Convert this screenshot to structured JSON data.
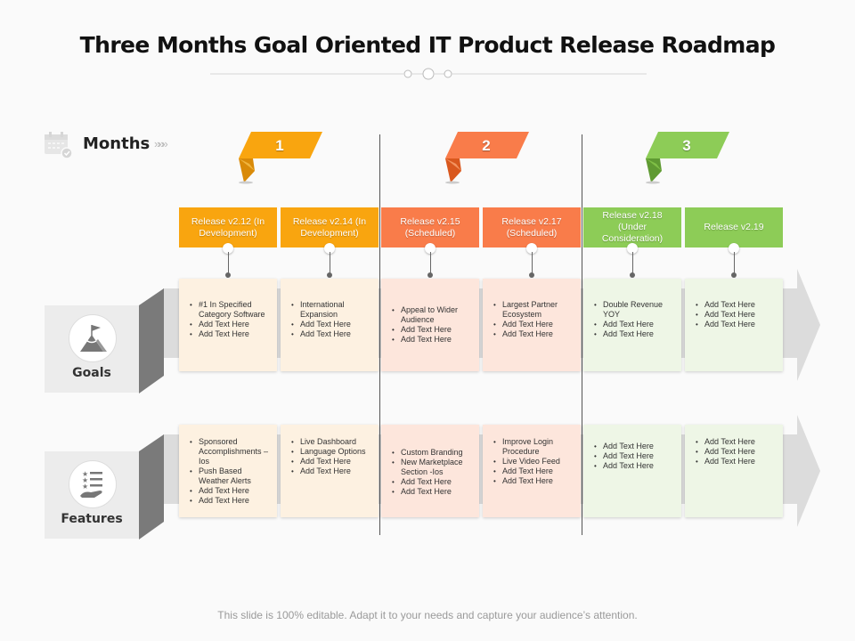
{
  "title": "Three Months Goal Oriented IT Product Release Roadmap",
  "months_header": {
    "label": "Months",
    "chevrons": "»»»",
    "icon": "calendar-check-icon"
  },
  "colors": {
    "month1": "#f9a50f",
    "month2": "#f97c4a",
    "month3": "#8dcc57",
    "month1_cell": "#fdf1e1",
    "month2_cell": "#fde6dc",
    "month3_cell": "#eef6e6",
    "band": "#dcdcdc",
    "fold": "#7a7a7a"
  },
  "months": [
    {
      "number": "1",
      "color_key": "month1"
    },
    {
      "number": "2",
      "color_key": "month2"
    },
    {
      "number": "3",
      "color_key": "month3"
    }
  ],
  "releases": [
    {
      "label": "Release v2.12 (In Development)",
      "month": 1
    },
    {
      "label": "Release v2.14 (In Development)",
      "month": 1
    },
    {
      "label": "Release v2.15 (Scheduled)",
      "month": 2
    },
    {
      "label": "Release v2.17 (Scheduled)",
      "month": 2
    },
    {
      "label": "Release v2.18 (Under Consideration)",
      "month": 3
    },
    {
      "label": "Release v2.19",
      "month": 3
    }
  ],
  "rows": [
    {
      "label": "Goals",
      "icon": "mountain-flag-icon",
      "cells": [
        [
          "#1 In Specified Category Software",
          "Add Text Here",
          "Add Text Here"
        ],
        [
          "International Expansion",
          "Add Text Here",
          "Add Text Here"
        ],
        [
          "Appeal to Wider Audience",
          "Add Text Here",
          "Add Text Here"
        ],
        [
          "Largest Partner Ecosystem",
          "Add Text Here",
          "Add Text Here"
        ],
        [
          "Double Revenue YOY",
          "Add Text Here",
          "Add Text Here"
        ],
        [
          "Add Text Here",
          "Add Text Here",
          "Add Text Here"
        ]
      ]
    },
    {
      "label": "Features",
      "icon": "star-list-hand-icon",
      "cells": [
        [
          "Sponsored Accomplishments – Ios",
          "Push Based Weather Alerts",
          "Add Text Here",
          "Add Text Here"
        ],
        [
          "Live Dashboard",
          "Language Options",
          "Add Text Here",
          "Add Text Here"
        ],
        [
          "Custom Branding",
          "New Marketplace Section -Ios",
          "Add Text Here",
          "Add Text Here"
        ],
        [
          "Improve Login Procedure",
          "Live Video Feed",
          "Add Text Here",
          "Add Text Here"
        ],
        [
          "Add Text Here",
          "Add Text Here",
          "Add Text Here"
        ],
        [
          "Add Text Here",
          "Add Text Here",
          "Add Text Here"
        ]
      ]
    }
  ],
  "footer": "This slide is 100% editable. Adapt it to your needs and capture your audience’s attention."
}
